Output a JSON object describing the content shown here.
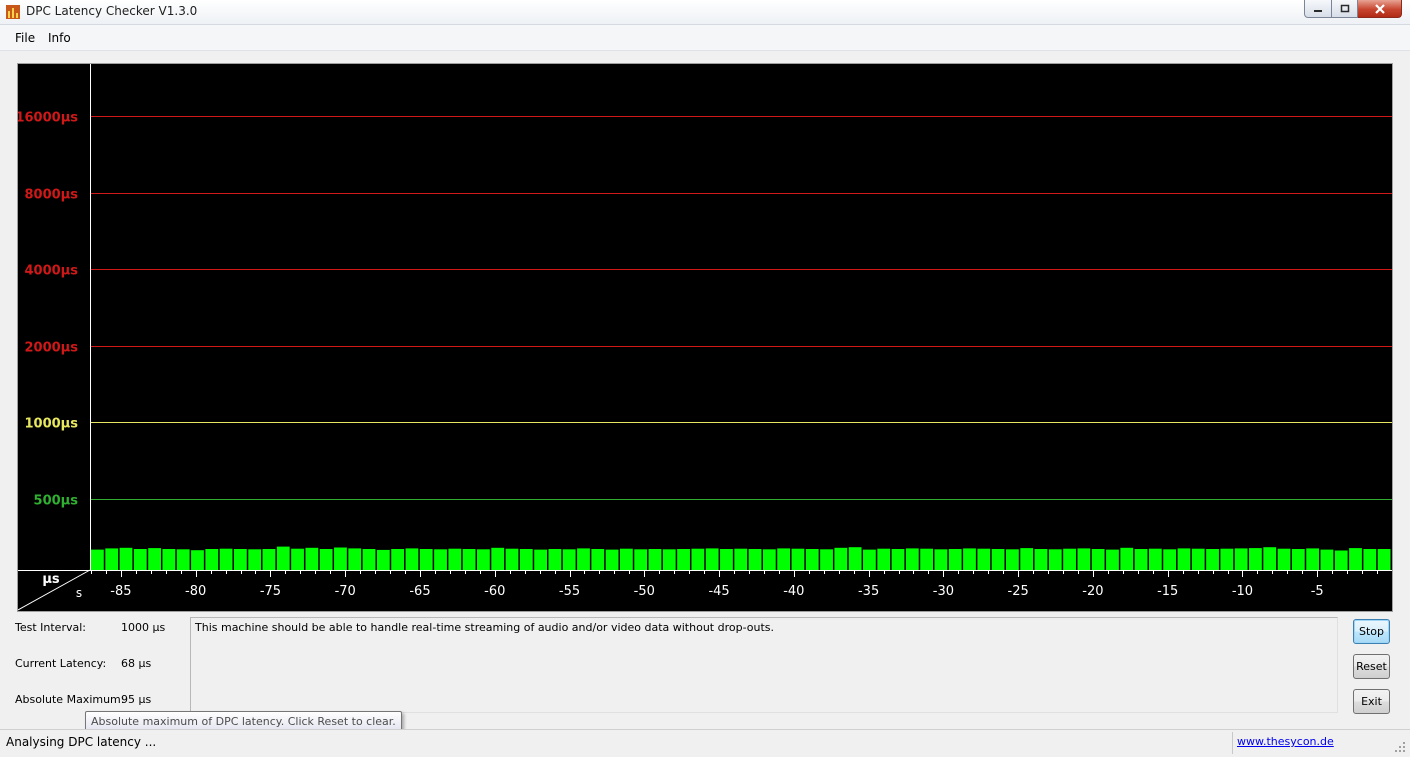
{
  "window": {
    "title": "DPC Latency Checker V1.3.0"
  },
  "menu": {
    "file": "File",
    "info": "Info"
  },
  "chart_data": {
    "type": "bar",
    "y_scale": "log",
    "unit_label_y": "µs",
    "unit_label_x": "s",
    "threshold_lines": [
      {
        "label": "16000µs",
        "value": 16000,
        "color": "#d01818"
      },
      {
        "label": "8000µs",
        "value": 8000,
        "color": "#d01818"
      },
      {
        "label": "4000µs",
        "value": 4000,
        "color": "#d01818"
      },
      {
        "label": "2000µs",
        "value": 2000,
        "color": "#d01818"
      },
      {
        "label": "1000µs",
        "value": 1000,
        "color": "#e8e860"
      },
      {
        "label": "500µs",
        "value": 500,
        "color": "#30b030"
      }
    ],
    "x_ticks": [
      "-85",
      "-80",
      "-75",
      "-70",
      "-65",
      "-60",
      "-55",
      "-50",
      "-45",
      "-40",
      "-35",
      "-30",
      "-25",
      "-20",
      "-15",
      "-10",
      "-5"
    ],
    "x_range": [
      -87,
      0
    ],
    "bar_color": "#00ff00",
    "values": [
      68,
      72,
      74,
      70,
      73,
      70,
      69,
      66,
      70,
      71,
      70,
      69,
      70,
      78,
      71,
      74,
      70,
      75,
      72,
      70,
      67,
      70,
      72,
      70,
      69,
      71,
      70,
      69,
      74,
      71,
      70,
      68,
      70,
      69,
      72,
      70,
      68,
      71,
      69,
      70,
      69,
      70,
      71,
      72,
      70,
      71,
      70,
      69,
      72,
      71,
      70,
      69,
      74,
      76,
      68,
      71,
      70,
      72,
      71,
      69,
      70,
      72,
      71,
      70,
      69,
      73,
      70,
      69,
      71,
      72,
      70,
      68,
      74,
      70,
      71,
      69,
      72,
      71,
      70,
      71,
      72,
      73,
      76,
      71,
      70,
      72,
      68,
      65,
      73,
      70,
      70
    ]
  },
  "stats": {
    "test_interval_label": "Test Interval:",
    "test_interval_value": "1000 µs",
    "current_latency_label": "Current Latency:",
    "current_latency_value": "68 µs",
    "absolute_max_label": "Absolute Maximum:",
    "absolute_max_value": "95 µs"
  },
  "message": "This machine should be able to handle real-time streaming of audio and/or video data without drop-outs.",
  "buttons": {
    "stop": "Stop",
    "reset": "Reset",
    "exit": "Exit"
  },
  "tooltip": "Absolute maximum of DPC latency. Click Reset to clear.",
  "status": {
    "text": "Analysing DPC latency ...",
    "link": "www.thesycon.de"
  }
}
